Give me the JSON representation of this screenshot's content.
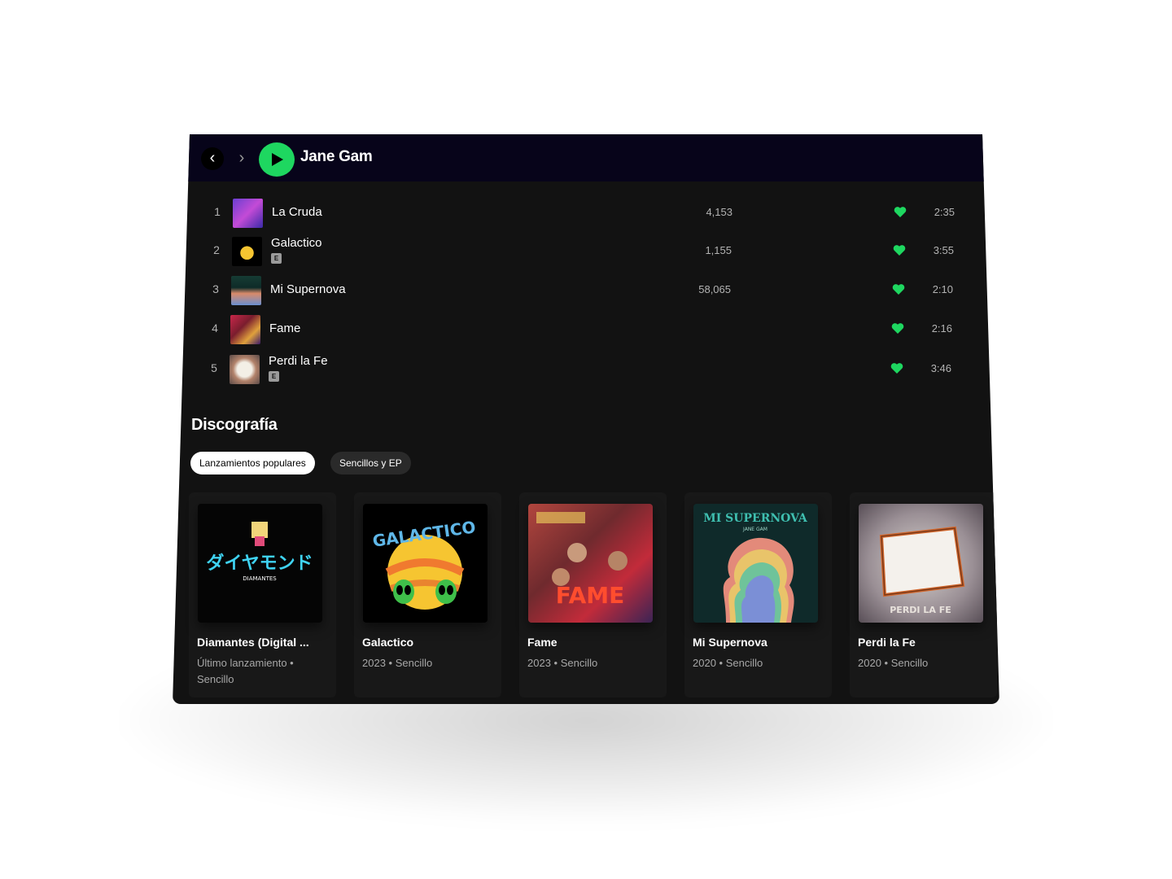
{
  "header": {
    "artist": "Jane Gam",
    "back_icon": "chevron-left-icon",
    "forward_icon": "chevron-right-icon",
    "play_icon": "play-icon"
  },
  "tracks": [
    {
      "num": "1",
      "title": "La Cruda",
      "explicit": false,
      "plays": "4,153",
      "duration": "2:35",
      "liked": true
    },
    {
      "num": "2",
      "title": "Galactico",
      "explicit": true,
      "explicit_label": "E",
      "plays": "1,155",
      "duration": "3:55",
      "liked": true
    },
    {
      "num": "3",
      "title": "Mi Supernova",
      "explicit": false,
      "plays": "58,065",
      "duration": "2:10",
      "liked": true
    },
    {
      "num": "4",
      "title": "Fame",
      "explicit": false,
      "plays": "",
      "duration": "2:16",
      "liked": true
    },
    {
      "num": "5",
      "title": "Perdi la Fe",
      "explicit": true,
      "explicit_label": "E",
      "plays": "",
      "duration": "3:46",
      "liked": true
    }
  ],
  "discography": {
    "title": "Discografía",
    "chips": [
      "Lanzamientos populares",
      "Sencillos y EP"
    ],
    "cards": [
      {
        "title": "Diamantes (Digital ...",
        "subtitle": "Último lanzamiento • Sencillo",
        "cover_text": "ダイヤモンド",
        "cover_subtext": "DIAMANTES"
      },
      {
        "title": "Galactico",
        "subtitle": "2023 • Sencillo",
        "cover_text": "GALACTICO"
      },
      {
        "title": "Fame",
        "subtitle": "2023 • Sencillo",
        "cover_text": "FAME"
      },
      {
        "title": "Mi Supernova",
        "subtitle": "2020 • Sencillo",
        "cover_text": "MI SUPERNOVA",
        "cover_subtext": "JANE GAM"
      },
      {
        "title": "Perdi la Fe",
        "subtitle": "2020 • Sencillo",
        "cover_text": "PERDI LA FE"
      }
    ]
  },
  "colors": {
    "accent": "#1ed760",
    "background": "#121212",
    "topbar": "#07041a",
    "card": "#181818"
  }
}
